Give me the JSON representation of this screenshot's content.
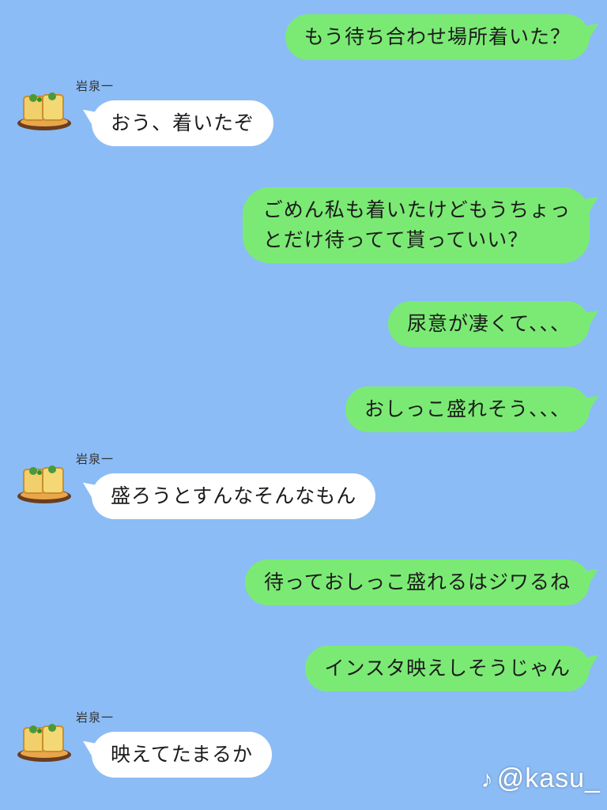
{
  "contact": {
    "name": "岩泉一"
  },
  "messages": [
    {
      "side": "me",
      "text": "もう待ち合わせ場所着いた？"
    },
    {
      "side": "them",
      "text": "おう、着いたぞ"
    },
    {
      "side": "me",
      "line1": "ごめん私も着いたけどもうちょっ",
      "line2": "とだけ待ってて貰っていい？"
    },
    {
      "side": "me",
      "text": "尿意が凄くて、、、"
    },
    {
      "side": "me",
      "text": "おしっこ盛れそう、、、"
    },
    {
      "side": "them",
      "text": "盛ろうとすんなそんなもん"
    },
    {
      "side": "me",
      "text": "待っておしっこ盛れるはジワるね"
    },
    {
      "side": "me",
      "text": "インスタ映えしそうじゃん"
    },
    {
      "side": "them",
      "text": "映えてたまるか"
    }
  ],
  "watermark": {
    "icon": "tiktok-icon",
    "text": "@kasu_"
  },
  "colors": {
    "background": "#8bbcf6",
    "my_bubble": "#7bea74",
    "their_bubble": "#ffffff"
  }
}
